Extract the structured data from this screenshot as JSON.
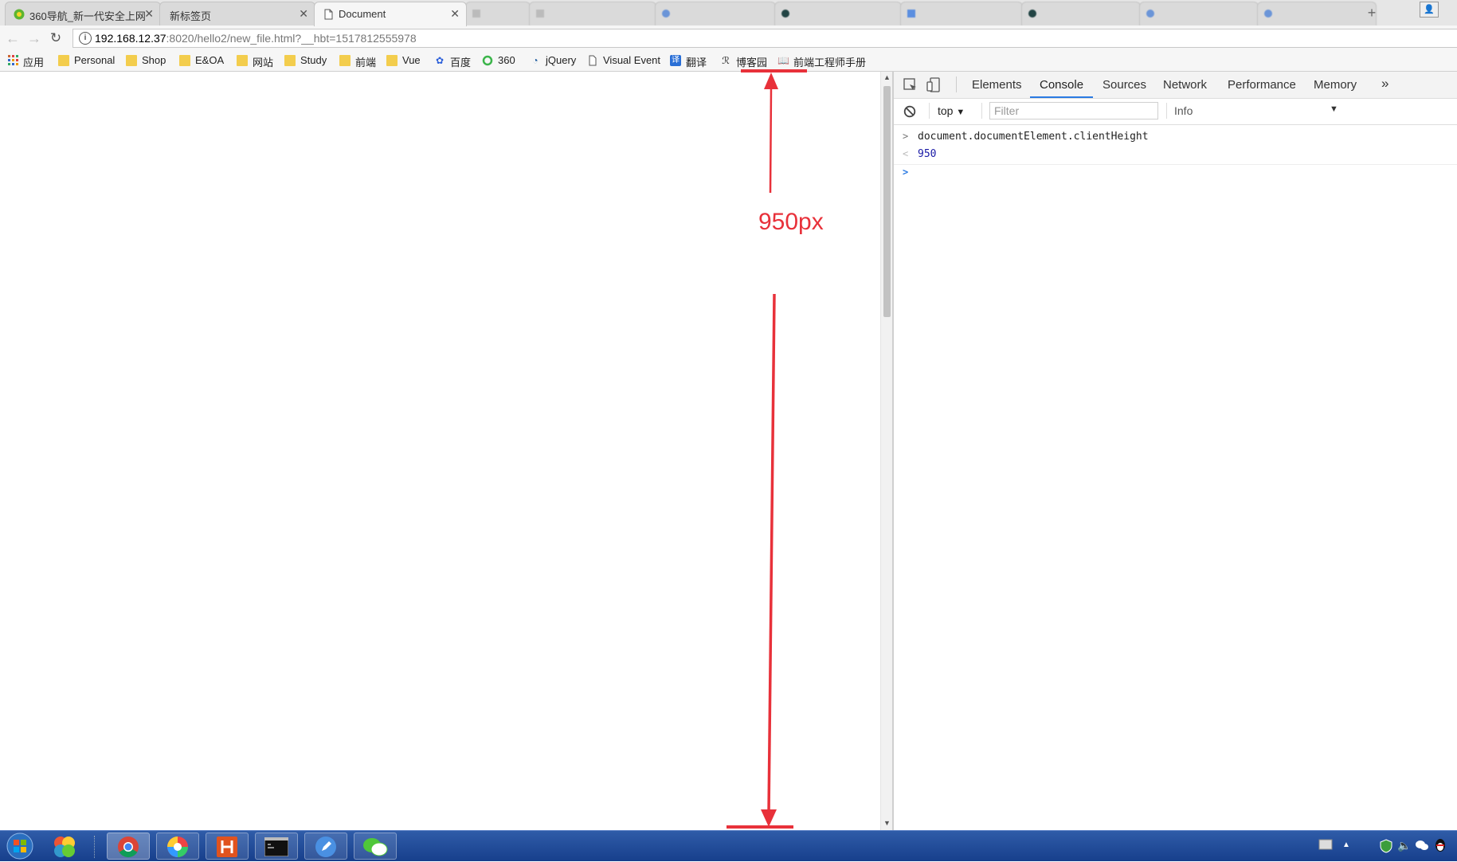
{
  "tabs": [
    {
      "label": "360导航_新一代安全上网",
      "icon": "360-icon",
      "active": false
    },
    {
      "label": "新标签页",
      "icon": "",
      "active": false
    },
    {
      "label": "Document",
      "icon": "page-icon",
      "active": true
    }
  ],
  "toolbar": {
    "url_host": "192.168.12.37",
    "url_rest": ":8020/hello2/new_file.html?__hbt=1517812555978"
  },
  "bookmarks": [
    {
      "label": "应用",
      "icon": "apps-grid-icon"
    },
    {
      "label": "Personal",
      "icon": "folder-icon"
    },
    {
      "label": "Shop",
      "icon": "folder-icon"
    },
    {
      "label": "E&OA",
      "icon": "folder-icon"
    },
    {
      "label": "网站",
      "icon": "folder-icon"
    },
    {
      "label": "Study",
      "icon": "folder-icon"
    },
    {
      "label": "前端",
      "icon": "folder-icon"
    },
    {
      "label": "Vue",
      "icon": "folder-icon"
    },
    {
      "label": "百度",
      "icon": "baidu-paw-icon"
    },
    {
      "label": "360",
      "icon": "360-ring-icon"
    },
    {
      "label": "jQuery",
      "icon": "jquery-icon"
    },
    {
      "label": "Visual Event",
      "icon": "page-icon"
    },
    {
      "label": "翻译",
      "icon": "translate-icon"
    },
    {
      "label": "博客园",
      "icon": "cnblogs-icon"
    },
    {
      "label": "前端工程师手册",
      "icon": "book-icon"
    }
  ],
  "devtools": {
    "tabs": [
      "Elements",
      "Console",
      "Sources",
      "Network",
      "Performance",
      "Memory"
    ],
    "active_tab": "Console",
    "context": "top",
    "filter_placeholder": "Filter",
    "level": "Info",
    "console": [
      {
        "type": "input",
        "text": "document.documentElement.clientHeight"
      },
      {
        "type": "output",
        "text": "950"
      },
      {
        "type": "prompt",
        "text": ""
      }
    ]
  },
  "annotation": {
    "label": "950px",
    "color": "#e8313a"
  },
  "colors": {
    "accent": "#2a7ae2",
    "annotation_red": "#e8313a",
    "taskbar": "#1f4a99"
  }
}
